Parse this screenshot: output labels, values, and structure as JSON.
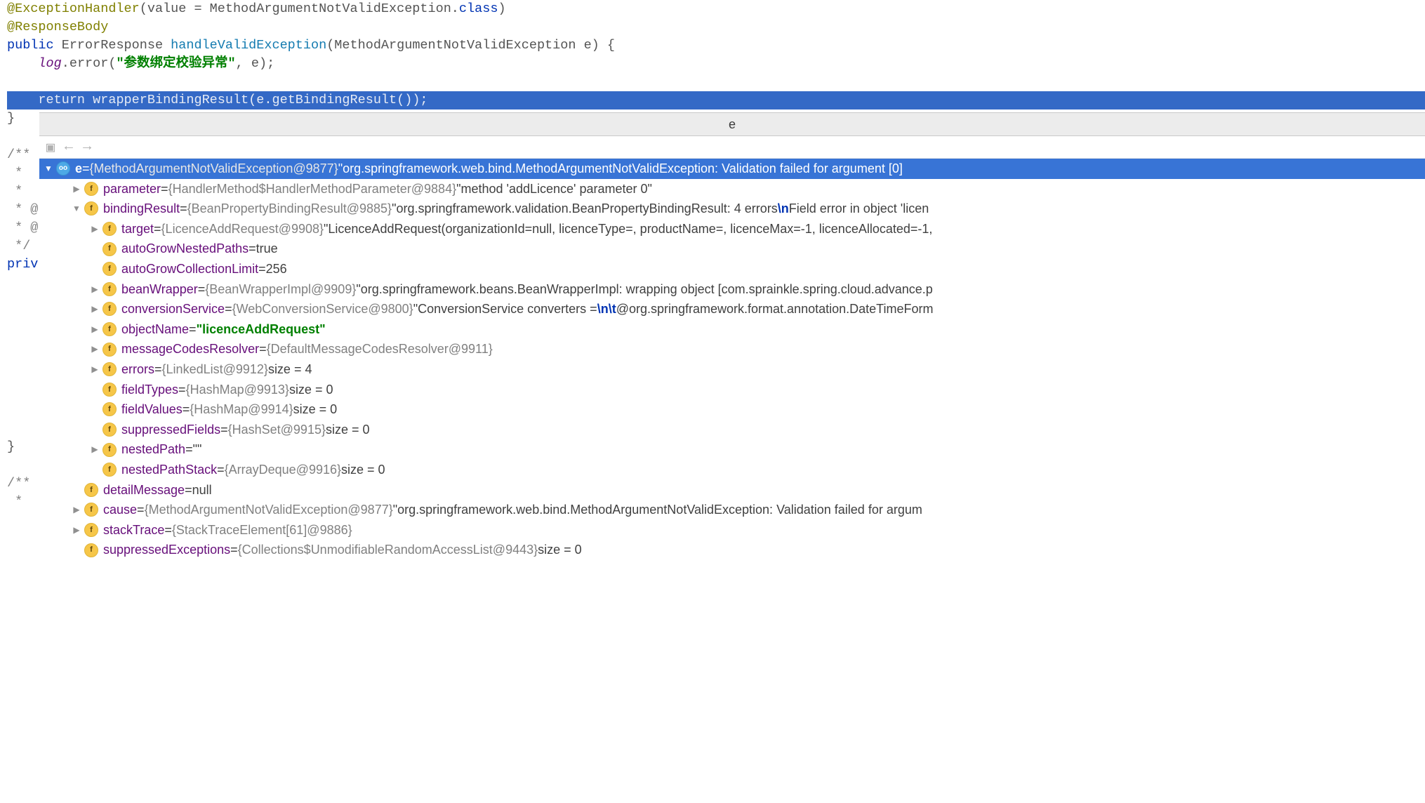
{
  "code": {
    "l1_annot": "@ExceptionHandler",
    "l1_rest": "(value = MethodArgumentNotValidException.",
    "l1_class": "class",
    "l1_end": ")",
    "l2": "@ResponseBody",
    "l3_public": "public",
    "l3_type": " ErrorResponse ",
    "l3_method": "handleValidException",
    "l3_rest": "(MethodArgumentNotValidException e) {",
    "l4_indent": "    ",
    "l4_log": "log",
    "l4_dot": ".error(",
    "l4_str": "\"参数绑定校验异常\"",
    "l4_rest": ", e);",
    "l6_indent": "    ",
    "l6_return": "return",
    "l6_rest": " wrapperBindingResult(e.getBindingResult());",
    "l7": "}",
    "l9": "/**",
    "l10": " * ",
    "l11": " *",
    "l12": " * @",
    "l13": " * @",
    "l14": " */",
    "l15": "priv",
    "l25": "}",
    "l27": "/**",
    "l28": " * "
  },
  "dbg": {
    "title": "e",
    "root": {
      "name": "e",
      "ref": "{MethodArgumentNotValidException@9877}",
      "val": "\"org.springframework.web.bind.MethodArgumentNotValidException: Validation failed for argument [0]"
    },
    "rows": [
      {
        "indent": 1,
        "arrow": "right",
        "badge": "f",
        "name": "parameter",
        "eq": " = ",
        "ref": "{HandlerMethod$HandlerMethodParameter@9884} ",
        "val": "\"method 'addLicence' parameter 0\""
      },
      {
        "indent": 1,
        "arrow": "down",
        "badge": "f",
        "name": "bindingResult",
        "eq": " = ",
        "ref": "{BeanPropertyBindingResult@9885} ",
        "val_parts": [
          "\"org.springframework.validation.BeanPropertyBindingResult: 4 errors",
          "\\n",
          "Field error in object 'licen"
        ]
      },
      {
        "indent": 2,
        "arrow": "right",
        "badge": "f",
        "name": "target",
        "eq": " = ",
        "ref": "{LicenceAddRequest@9908} ",
        "val": "\"LicenceAddRequest(organizationId=null, licenceType=, productName=, licenceMax=-1, licenceAllocated=-1,"
      },
      {
        "indent": 2,
        "arrow": "",
        "badge": "f",
        "name": "autoGrowNestedPaths",
        "eq": " = ",
        "plain": "true"
      },
      {
        "indent": 2,
        "arrow": "",
        "badge": "f",
        "name": "autoGrowCollectionLimit",
        "eq": " = ",
        "plain": "256"
      },
      {
        "indent": 2,
        "arrow": "right",
        "badge": "f",
        "name": "beanWrapper",
        "eq": " = ",
        "ref": "{BeanWrapperImpl@9909} ",
        "val": "\"org.springframework.beans.BeanWrapperImpl: wrapping object [com.sprainkle.spring.cloud.advance.p"
      },
      {
        "indent": 2,
        "arrow": "right",
        "badge": "f",
        "name": "conversionService",
        "eq": " = ",
        "ref": "{WebConversionService@9800} ",
        "val_parts": [
          "\"ConversionService converters =",
          "\\n\\t",
          "@org.springframework.format.annotation.DateTimeForm"
        ]
      },
      {
        "indent": 2,
        "arrow": "right",
        "badge": "f",
        "name": "objectName",
        "eq": " = ",
        "green": "\"licenceAddRequest\""
      },
      {
        "indent": 2,
        "arrow": "right",
        "badge": "f",
        "name": "messageCodesResolver",
        "eq": " = ",
        "ref": "{DefaultMessageCodesResolver@9911}"
      },
      {
        "indent": 2,
        "arrow": "right",
        "badge": "f",
        "name": "errors",
        "eq": " = ",
        "ref": "{LinkedList@9912} ",
        "size": " size = 4"
      },
      {
        "indent": 2,
        "arrow": "",
        "badge": "f",
        "name": "fieldTypes",
        "eq": " = ",
        "ref": "{HashMap@9913} ",
        "size": " size = 0"
      },
      {
        "indent": 2,
        "arrow": "",
        "badge": "f",
        "name": "fieldValues",
        "eq": " = ",
        "ref": "{HashMap@9914} ",
        "size": " size = 0"
      },
      {
        "indent": 2,
        "arrow": "",
        "badge": "f",
        "name": "suppressedFields",
        "eq": " = ",
        "ref": "{HashSet@9915} ",
        "size": " size = 0"
      },
      {
        "indent": 2,
        "arrow": "right",
        "badge": "f",
        "name": "nestedPath",
        "eq": " = ",
        "plain": "\"\""
      },
      {
        "indent": 2,
        "arrow": "",
        "badge": "f",
        "name": "nestedPathStack",
        "eq": " = ",
        "ref": "{ArrayDeque@9916} ",
        "size": " size = 0"
      },
      {
        "indent": 1,
        "arrow": "",
        "badge": "f",
        "name": "detailMessage",
        "eq": " = ",
        "plain": "null"
      },
      {
        "indent": 1,
        "arrow": "right",
        "badge": "f",
        "name": "cause",
        "eq": " = ",
        "ref": "{MethodArgumentNotValidException@9877} ",
        "val": "\"org.springframework.web.bind.MethodArgumentNotValidException: Validation failed for argum"
      },
      {
        "indent": 1,
        "arrow": "right",
        "badge": "f",
        "name": "stackTrace",
        "eq": " = ",
        "ref": "{StackTraceElement[61]@9886}"
      },
      {
        "indent": 1,
        "arrow": "",
        "badge": "f",
        "name": "suppressedExceptions",
        "eq": " = ",
        "ref": "{Collections$UnmodifiableRandomAccessList@9443} ",
        "size": " size = 0"
      }
    ]
  }
}
